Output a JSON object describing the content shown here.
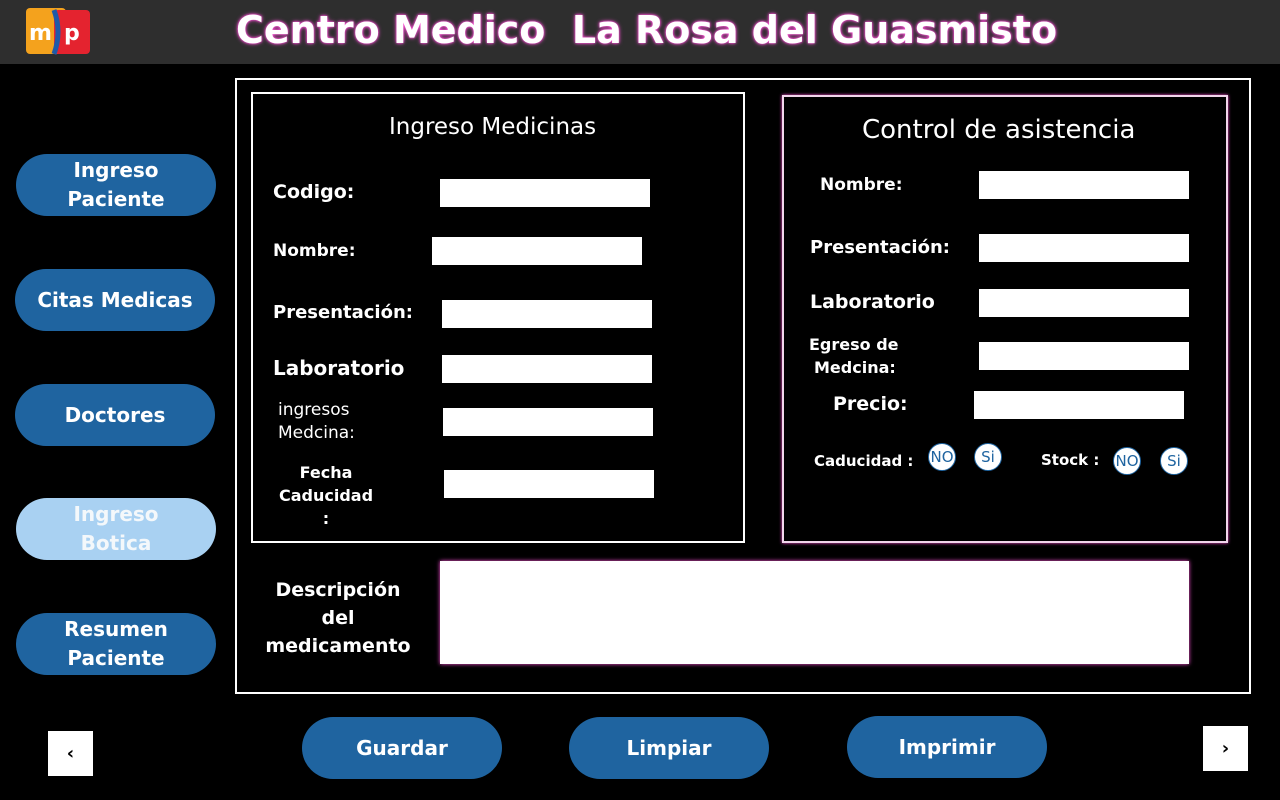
{
  "header": {
    "title": "Centro Medico  La Rosa del Guasmisto",
    "logo_text": "msp"
  },
  "sidebar": {
    "items": [
      {
        "label_line1": "Ingreso",
        "label_line2": "Paciente"
      },
      {
        "label_line1": "Citas Medicas",
        "label_line2": ""
      },
      {
        "label_line1": "Doctores",
        "label_line2": ""
      },
      {
        "label_line1": "Ingreso",
        "label_line2": "Botica",
        "active": true
      },
      {
        "label_line1": "Resumen",
        "label_line2": "Paciente"
      }
    ]
  },
  "medicinas": {
    "title": "Ingreso Medicinas",
    "codigo_label": "Codigo:",
    "nombre_label": "Nombre:",
    "presentacion_label": "Presentación:",
    "laboratorio_label": "Laboratorio",
    "ingresos_line1": "ingresos",
    "ingresos_line2": "Medcina:",
    "fecha_line1": "Fecha",
    "fecha_line2": "Caducidad :"
  },
  "asistencia": {
    "title": "Control de asistencia",
    "nombre_label": "Nombre:",
    "presentacion_label": "Presentación:",
    "laboratorio_label": "Laboratorio",
    "egreso_line1": "Egreso de",
    "egreso_line2": "Medcina:",
    "precio_label": "Precio:",
    "caducidad_label": "Caducidad :",
    "stock_label": "Stock :",
    "option_no": "NO",
    "option_si": "Si"
  },
  "descripcion": {
    "line1": "Descripción",
    "line2": "del medicamento"
  },
  "actions": {
    "guardar": "Guardar",
    "limpiar": "Limpiar",
    "imprimir": "Imprimir"
  },
  "nav_arrows": {
    "prev": "‹",
    "next": "›"
  },
  "colors": {
    "button_blue": "#1f64a0",
    "active_button": "#a9d1f2",
    "title_glow": "#ff4fd8",
    "topbar": "#2e2e2e"
  }
}
